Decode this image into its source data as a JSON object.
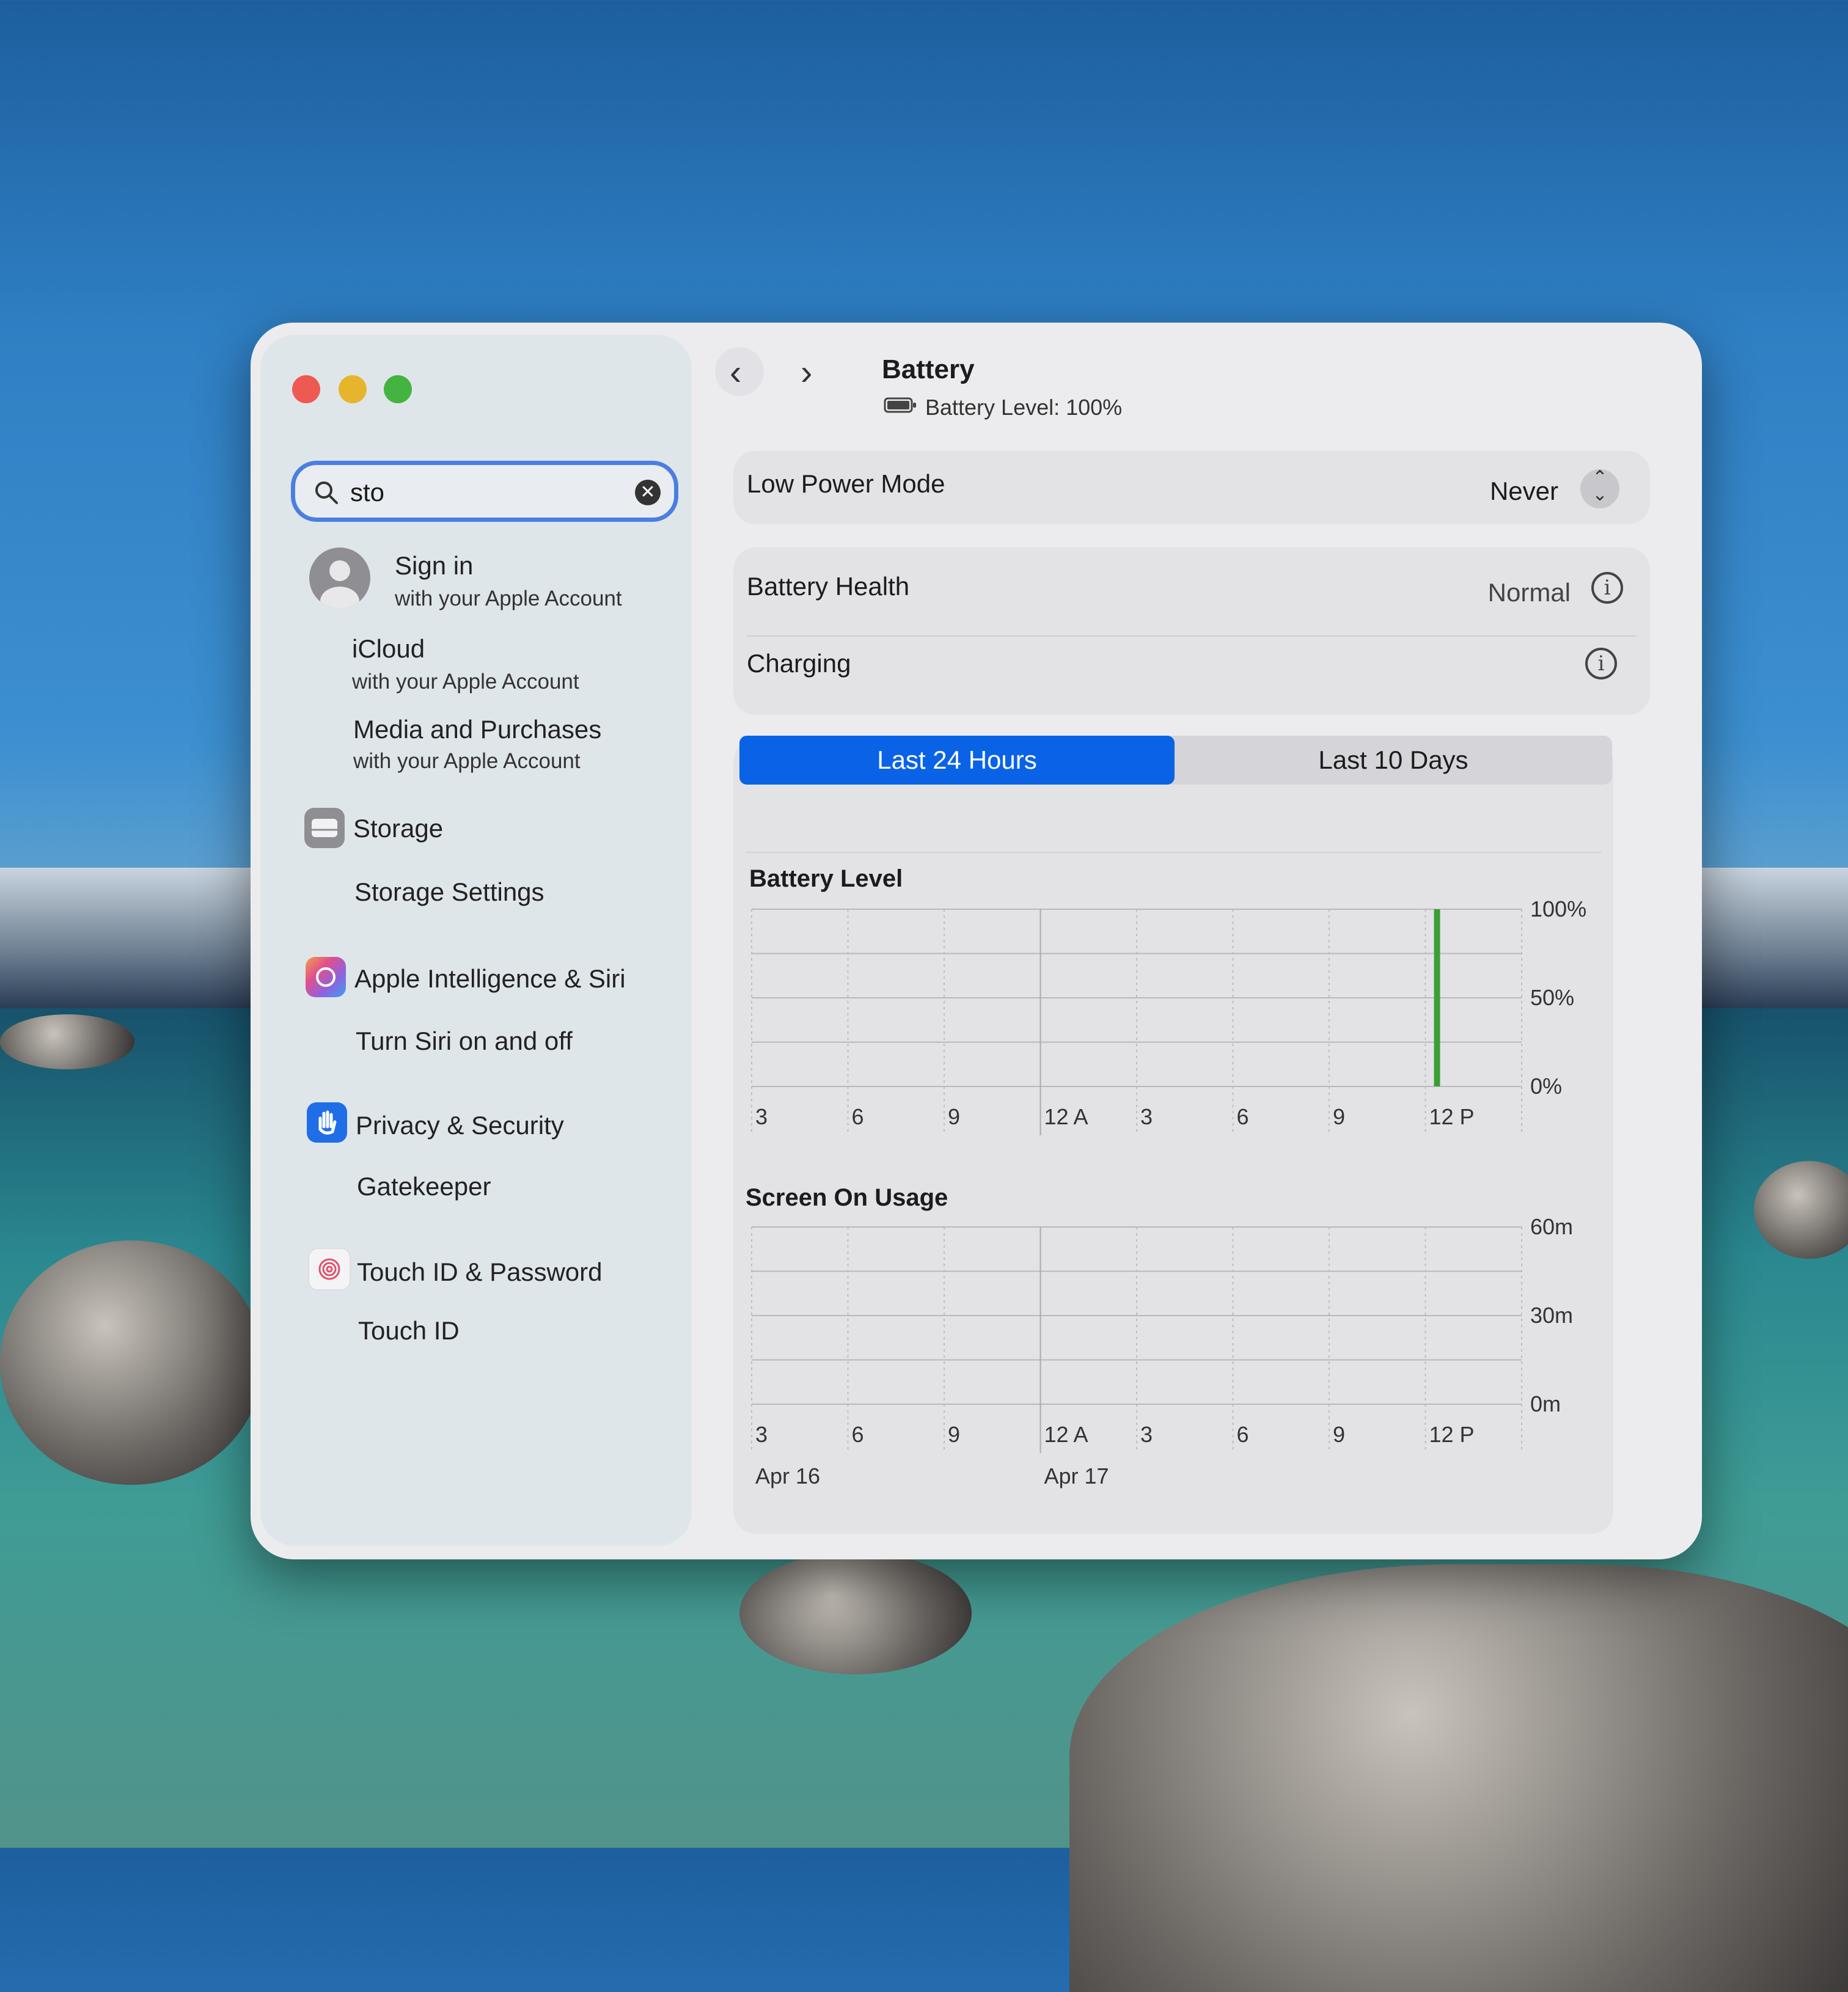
{
  "window": {
    "title": "Battery",
    "subtitle": "Battery Level: 100%"
  },
  "sidebar": {
    "search": {
      "value": "sto"
    },
    "account": {
      "title": "Sign in",
      "subtitle": "with your Apple Account"
    },
    "results": [
      {
        "title": "iCloud",
        "subtitle": "with your Apple Account"
      },
      {
        "title": "Media and Purchases",
        "subtitle": "with your Apple Account"
      }
    ],
    "sections": [
      {
        "title": "Storage",
        "item": "Storage Settings",
        "icon": "storage-icon"
      },
      {
        "title": "Apple Intelligence & Siri",
        "item": "Turn Siri on and off",
        "icon": "siri-icon"
      },
      {
        "title": "Privacy & Security",
        "item": "Gatekeeper",
        "icon": "hand-icon"
      },
      {
        "title": "Touch ID & Password",
        "item": "Touch ID",
        "icon": "fingerprint-icon"
      }
    ]
  },
  "settings": {
    "low_power_mode": {
      "label": "Low Power Mode",
      "value": "Never"
    },
    "battery_health": {
      "label": "Battery Health",
      "value": "Normal"
    },
    "charging": {
      "label": "Charging"
    }
  },
  "tabs": {
    "active": "Last 24 Hours",
    "inactive": "Last 10 Days"
  },
  "colors": {
    "accent": "#0a63e6",
    "battery_bar": "#3aa035"
  },
  "chart_data": [
    {
      "type": "bar",
      "title": "Battery Level",
      "x_ticks": [
        "3",
        "6",
        "9",
        "12 A",
        "3",
        "6",
        "9",
        "12 P"
      ],
      "y_ticks": [
        "100%",
        "50%",
        "0%"
      ],
      "ylim": [
        0,
        100
      ],
      "series": [
        {
          "x": "12 P",
          "values": [
            100
          ]
        }
      ],
      "grid": true
    },
    {
      "type": "bar",
      "title": "Screen On Usage",
      "x_ticks": [
        "3",
        "6",
        "9",
        "12 A",
        "3",
        "6",
        "9",
        "12 P"
      ],
      "date_labels": [
        "Apr 16",
        "Apr 17"
      ],
      "y_ticks": [
        "60m",
        "30m",
        "0m"
      ],
      "ylim": [
        0,
        60
      ],
      "series": [],
      "grid": true
    }
  ]
}
